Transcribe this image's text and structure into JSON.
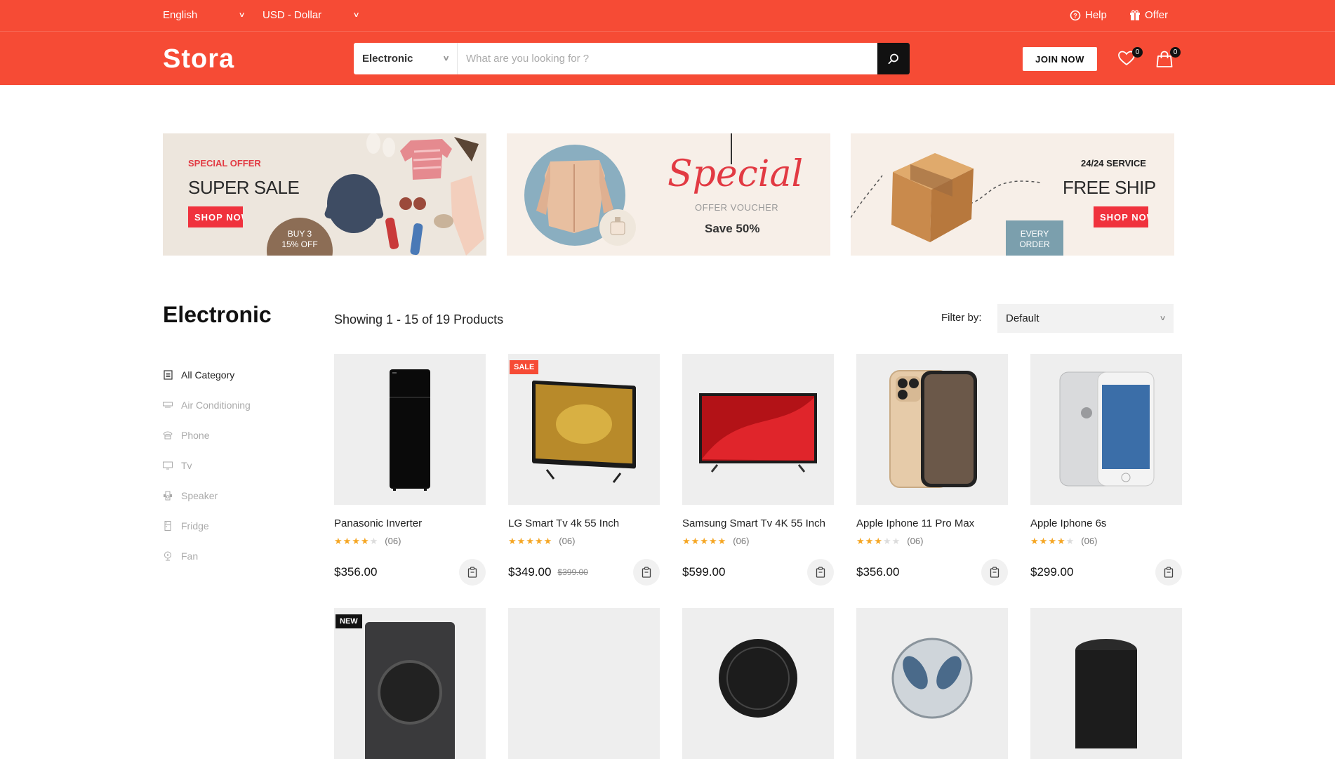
{
  "topbar": {
    "language": "English",
    "currency": "USD - Dollar",
    "help_label": "Help",
    "offer_label": "Offer"
  },
  "header": {
    "logo": "Stora",
    "search_category": "Electronic",
    "search_placeholder": "What are you looking for ?",
    "join_label": "JOIN NOW",
    "wishlist_count": "0",
    "cart_count": "0"
  },
  "banners": [
    {
      "kicker": "SPECIAL OFFER",
      "title": "SUPER SALE",
      "button": "SHOP NOW",
      "badge_line1": "BUY 3",
      "badge_line2": "15% OFF"
    },
    {
      "script_title": "Special",
      "subtitle": "OFFER VOUCHER",
      "detail": "Save 50%"
    },
    {
      "kicker": "24/24 SERVICE",
      "title": "FREE SHIP",
      "button": "SHOP NOW",
      "badge_line1": "EVERY",
      "badge_line2": "ORDER"
    }
  ],
  "sidebar": {
    "title": "Electronic",
    "items": [
      {
        "label": "All Category",
        "icon": "list-icon"
      },
      {
        "label": "Air Conditioning",
        "icon": "air-conditioner-icon"
      },
      {
        "label": "Phone",
        "icon": "phone-icon"
      },
      {
        "label": "Tv",
        "icon": "tv-icon"
      },
      {
        "label": "Speaker",
        "icon": "speaker-icon"
      },
      {
        "label": "Fridge",
        "icon": "fridge-icon"
      },
      {
        "label": "Fan",
        "icon": "fan-icon"
      }
    ]
  },
  "listing": {
    "showing": "Showing 1 - 15 of 19 Products",
    "filter_label": "Filter by:",
    "filter_value": "Default"
  },
  "colors": {
    "brand": "#f64b35",
    "star": "#f5a623",
    "sale": "#f64b35",
    "new": "#111111"
  },
  "products": [
    {
      "name": "Panasonic Inverter",
      "rating": 4,
      "reviews": "(06)",
      "price": "$356.00",
      "old_price": "",
      "tag": "",
      "image": "fridge"
    },
    {
      "name": "LG Smart Tv 4k 55 Inch",
      "rating": 5,
      "reviews": "(06)",
      "price": "$349.00",
      "old_price": "$399.00",
      "tag": "SALE",
      "image": "tv-gold"
    },
    {
      "name": "Samsung Smart Tv 4K 55 Inch",
      "rating": 5,
      "reviews": "(06)",
      "price": "$599.00",
      "old_price": "",
      "tag": "",
      "image": "tv-red"
    },
    {
      "name": "Apple Iphone 11 Pro Max",
      "rating": 3,
      "reviews": "(06)",
      "price": "$356.00",
      "old_price": "",
      "tag": "",
      "image": "iphone11"
    },
    {
      "name": "Apple Iphone 6s",
      "rating": 4,
      "reviews": "(06)",
      "price": "$299.00",
      "old_price": "",
      "tag": "",
      "image": "iphone6"
    },
    {
      "name": "",
      "rating": 0,
      "reviews": "",
      "price": "",
      "old_price": "",
      "tag": "NEW",
      "image": "washer"
    },
    {
      "name": "",
      "rating": 0,
      "reviews": "",
      "price": "",
      "old_price": "",
      "tag": "",
      "image": "blank"
    },
    {
      "name": "",
      "rating": 0,
      "reviews": "",
      "price": "",
      "old_price": "",
      "tag": "",
      "image": "fan-black"
    },
    {
      "name": "",
      "rating": 0,
      "reviews": "",
      "price": "",
      "old_price": "",
      "tag": "",
      "image": "fan-blue"
    },
    {
      "name": "",
      "rating": 0,
      "reviews": "",
      "price": "",
      "old_price": "",
      "tag": "",
      "image": "speaker-black"
    }
  ]
}
